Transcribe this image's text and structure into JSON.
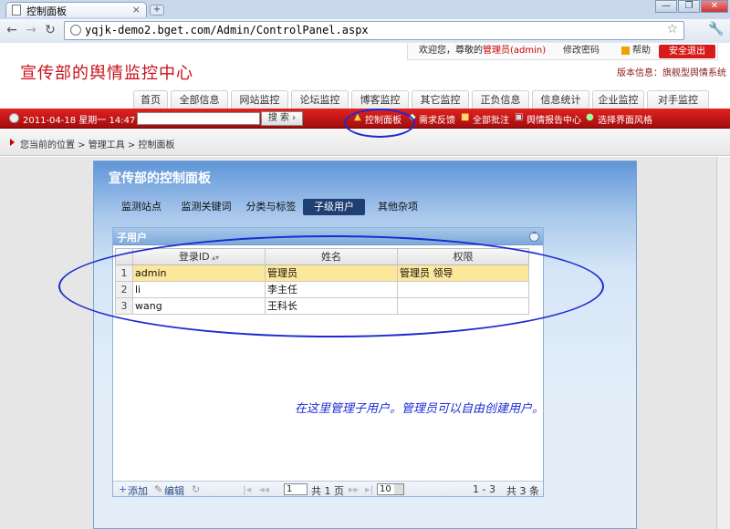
{
  "browser": {
    "tab_title": "控制面板",
    "url": "yqjk-demo2.bget.com/Admin/ControlPanel.aspx",
    "new_tab": "+",
    "win_min": "—",
    "win_max": "❐",
    "win_close": "✕"
  },
  "header": {
    "welcome": "欢迎您，尊敬的",
    "user": "管理员(admin)",
    "change_password": "修改密码",
    "help": "帮助",
    "logout": "安全退出",
    "site_title": "宣传部的舆情监控中心",
    "version": "版本信息：旗舰型舆情系统"
  },
  "main_tabs": [
    "首页",
    "全部信息",
    "网站监控",
    "论坛监控",
    "博客监控",
    "其它监控",
    "正负信息",
    "信息统计",
    "企业监控",
    "对手监控"
  ],
  "toolbar": {
    "date": "2011-04-18 星期一 14:47",
    "search_button": "搜 索 ›",
    "tools": [
      "控制面板",
      "需求反馈",
      "全部批注",
      "舆情报告中心",
      "选择界面风格"
    ]
  },
  "breadcrumb": "您当前的位置 > 管理工具 > 控制面板",
  "panel": {
    "title": "宣传部的控制面板",
    "tabs": [
      "监测站点",
      "监测关键词",
      "分类与标签",
      "子级用户",
      "其他杂项"
    ],
    "active_tab": "子级用户"
  },
  "grid": {
    "title": "子用户",
    "columns": [
      "登录ID",
      "姓名",
      "权限"
    ],
    "rows": [
      {
        "n": "1",
        "id": "admin",
        "name": "管理员",
        "perm": "管理员 领导"
      },
      {
        "n": "2",
        "id": "li",
        "name": "李主任",
        "perm": ""
      },
      {
        "n": "3",
        "id": "wang",
        "name": "王科长",
        "perm": ""
      }
    ],
    "pager": {
      "add": "添加",
      "edit": "编辑",
      "page_value": "1",
      "page_total": "共 1 页",
      "page_size": "10",
      "range": "1 - 3",
      "count": "共 3 条"
    }
  },
  "annotation": "在这里管理子用户。管理员可以自由创建用户。",
  "colors": {
    "accent_red": "#d81b1b",
    "panel_blue": "#5f96d8",
    "annotation_blue": "#1c2ed8",
    "selected_row": "#fce79a"
  }
}
